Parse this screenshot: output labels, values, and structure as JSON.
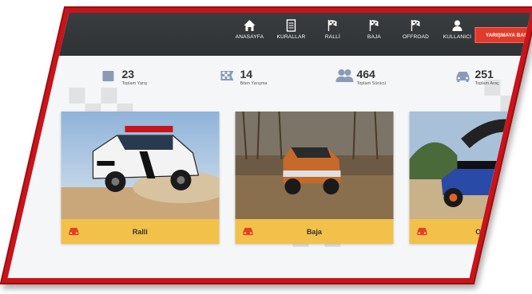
{
  "nav": {
    "items": [
      {
        "label": "ANASAYFA",
        "icon": "home-icon"
      },
      {
        "label": "KURALLAR",
        "icon": "rules-icon"
      },
      {
        "label": "RALLİ",
        "icon": "flag-icon"
      },
      {
        "label": "BAJA",
        "icon": "flag-icon"
      },
      {
        "label": "OFFROAD",
        "icon": "flag-icon"
      },
      {
        "label": "KULLANICI",
        "icon": "user-icon"
      }
    ],
    "cta_label": "YARIŞMAYA BAŞLA"
  },
  "stats": [
    {
      "value": "23",
      "label": "Toplam Yarış",
      "icon": "calendar-icon"
    },
    {
      "value": "14",
      "label": "Biten Yarışma",
      "icon": "checkered-flag-icon"
    },
    {
      "value": "464",
      "label": "Toplam Sürücü",
      "icon": "users-icon"
    },
    {
      "value": "251",
      "label": "Toplam Araç",
      "icon": "car-icon"
    }
  ],
  "cards": [
    {
      "title": "Ralli",
      "icon": "car-icon"
    },
    {
      "title": "Baja",
      "icon": "car-icon"
    },
    {
      "title": "Offroad",
      "icon": "car-icon"
    }
  ],
  "colors": {
    "frame": "#c8141a",
    "nav": "#33363a",
    "cta": "#e23a2a",
    "card_bar": "#f2c14a",
    "car_icon": "#e8401f"
  }
}
